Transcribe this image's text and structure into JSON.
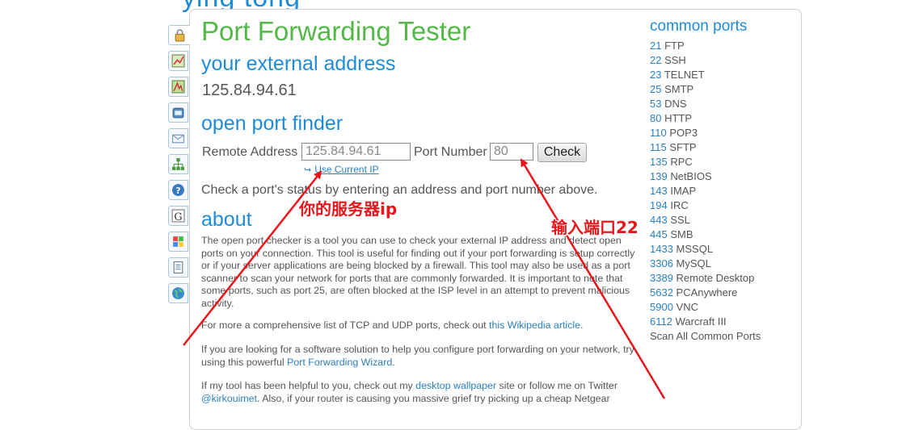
{
  "page": {
    "cut_title": "ying tong",
    "title": "Port Forwarding Tester"
  },
  "sidebar": {
    "tabs": [
      {
        "icon": "lock-icon"
      },
      {
        "icon": "chart-icon"
      },
      {
        "icon": "map-icon"
      },
      {
        "icon": "phone-icon"
      },
      {
        "icon": "envelope-icon"
      },
      {
        "icon": "network-icon"
      },
      {
        "icon": "help-icon"
      },
      {
        "icon": "google-icon"
      },
      {
        "icon": "windows-icon"
      },
      {
        "icon": "document-icon"
      },
      {
        "icon": "globe-icon"
      }
    ]
  },
  "external": {
    "heading": "your external address",
    "ip": "125.84.94.61"
  },
  "finder": {
    "heading": "open port finder",
    "remote_label": "Remote Address",
    "remote_value": "125.84.94.61",
    "port_label": "Port Number",
    "port_value": "80",
    "check_label": "Check",
    "use_current_ip": "Use Current IP",
    "hint": "Check a port's status by entering an address and port number above."
  },
  "about": {
    "heading": "about",
    "p1": "The open port checker is a tool you can use to check your external IP address and detect open ports on your connection. This tool is useful for finding out if your port forwarding is setup correctly or if your server applications are being blocked by a firewall. This tool may also be used as a port scanner to scan your network for ports that are commonly forwarded. It is important to note that some ports, such as port 25, are often blocked at the ISP level in an attempt to prevent malicious activity.",
    "p2_before": "For more a comprehensive list of TCP and UDP ports, check out ",
    "p2_link": "this Wikipedia article",
    "p2_after": ".",
    "p3_before": "If you are looking for a software solution to help you configure port forwarding on your network, try using this powerful ",
    "p3_link": "Port Forwarding Wizard",
    "p3_after": ".",
    "p4_a": "If my tool has been helpful to you, check out my ",
    "p4_link1": "desktop wallpaper",
    "p4_b": " site or follow me on Twitter ",
    "p4_link2": "@kirkouimet",
    "p4_c": ". Also, if your router is causing you massive grief try picking up a cheap Netgear"
  },
  "common_ports": {
    "title": "common ports",
    "items": [
      {
        "port": "21",
        "name": "FTP"
      },
      {
        "port": "22",
        "name": "SSH"
      },
      {
        "port": "23",
        "name": "TELNET"
      },
      {
        "port": "25",
        "name": "SMTP"
      },
      {
        "port": "53",
        "name": "DNS"
      },
      {
        "port": "80",
        "name": "HTTP"
      },
      {
        "port": "110",
        "name": "POP3"
      },
      {
        "port": "115",
        "name": "SFTP"
      },
      {
        "port": "135",
        "name": "RPC"
      },
      {
        "port": "139",
        "name": "NetBIOS"
      },
      {
        "port": "143",
        "name": "IMAP"
      },
      {
        "port": "194",
        "name": "IRC"
      },
      {
        "port": "443",
        "name": "SSL"
      },
      {
        "port": "445",
        "name": "SMB"
      },
      {
        "port": "1433",
        "name": "MSSQL"
      },
      {
        "port": "3306",
        "name": "MySQL"
      },
      {
        "port": "3389",
        "name": "Remote Desktop"
      },
      {
        "port": "5632",
        "name": "PCAnywhere"
      },
      {
        "port": "5900",
        "name": "VNC"
      },
      {
        "port": "6112",
        "name": "Warcraft III"
      }
    ],
    "scan_all": "Scan All Common Ports"
  },
  "annotations": {
    "server_ip": "你的服务器ip",
    "enter_port": "输入端口22",
    "color": "#e8151b"
  }
}
